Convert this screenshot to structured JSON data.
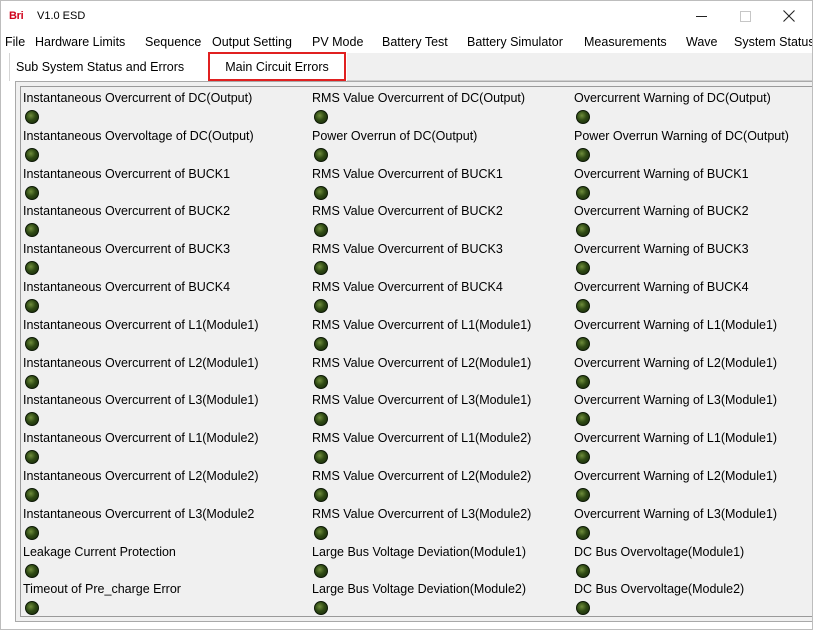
{
  "window": {
    "logo": "Bri",
    "title": "V1.0  ESD"
  },
  "menubar": {
    "items": [
      "File",
      "Hardware Limits",
      "Sequence",
      "Output Setting",
      "PV Mode",
      "Battery Test",
      "Battery Simulator",
      "Measurements",
      "Wave",
      "System Status"
    ]
  },
  "tabs": {
    "sub_system": "Sub System Status and Errors",
    "main_circuit": "Main Circuit Errors",
    "active": "main_circuit"
  },
  "indicators": {
    "off_color": "#2f4a14",
    "rows": [
      [
        "Instantaneous Overcurrent  of DC(Output)",
        "RMS Value Overcurrent of DC(Output)",
        "Overcurrent Warning of DC(Output)"
      ],
      [
        "Instantaneous Overvoltage  of DC(Output)",
        "Power Overrun of DC(Output)",
        "Power Overrun Warning of DC(Output)"
      ],
      [
        "Instantaneous Overcurrent  of BUCK1",
        "RMS Value Overcurrent of BUCK1",
        "Overcurrent Warning of BUCK1"
      ],
      [
        "Instantaneous Overcurrent  of BUCK2",
        "RMS Value Overcurrent of BUCK2",
        "Overcurrent Warning of BUCK2"
      ],
      [
        "Instantaneous Overcurrent  of BUCK3",
        "RMS Value Overcurrent of BUCK3",
        "Overcurrent Warning of BUCK3"
      ],
      [
        "Instantaneous Overcurrent  of BUCK4",
        "RMS Value Overcurrent of BUCK4",
        "Overcurrent Warning of BUCK4"
      ],
      [
        "Instantaneous Overcurrent  of L1(Module1)",
        "RMS Value Overcurrent of L1(Module1)",
        "Overcurrent Warning of L1(Module1)"
      ],
      [
        "Instantaneous Overcurrent  of L2(Module1)",
        "RMS Value Overcurrent of L2(Module1)",
        "Overcurrent Warning of L2(Module1)"
      ],
      [
        "Instantaneous Overcurrent  of L3(Module1)",
        "RMS Value Overcurrent of L3(Module1)",
        "Overcurrent Warning of L3(Module1)"
      ],
      [
        "Instantaneous Overcurrent  of L1(Module2)",
        "RMS Value Overcurrent of L1(Module2)",
        "Overcurrent Warning of L1(Module1)"
      ],
      [
        "Instantaneous Overcurrent  of L2(Module2)",
        "RMS Value Overcurrent of L2(Module2)",
        "Overcurrent Warning of L2(Module1)"
      ],
      [
        "Instantaneous Overcurrent  of L3(Module2",
        "RMS Value Overcurrent of L3(Module2)",
        "Overcurrent Warning of L3(Module1)"
      ],
      [
        "Leakage Current Protection",
        "Large Bus Voltage Deviation(Module1)",
        "DC Bus Overvoltage(Module1)"
      ],
      [
        "Timeout of Pre_charge Error",
        "Large Bus Voltage Deviation(Module2)",
        "DC Bus Overvoltage(Module2)"
      ]
    ]
  }
}
